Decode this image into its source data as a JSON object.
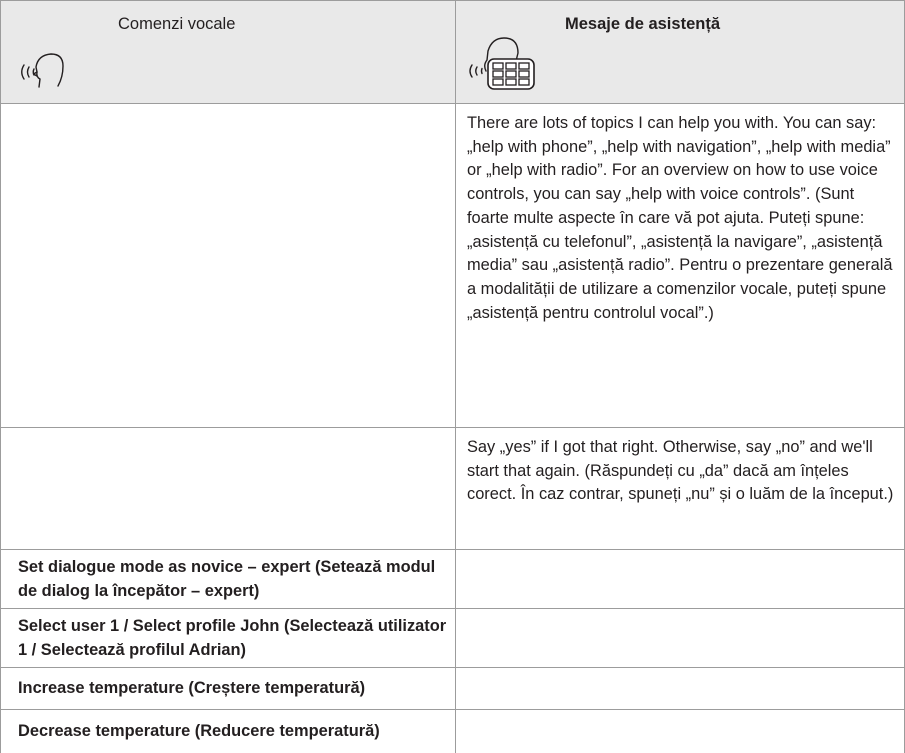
{
  "header": {
    "left_title": "Comenzi vocale",
    "right_title": "Mesaje de asistență",
    "left_icon": "voice-speaking-head-icon",
    "right_icon": "speaking-head-keypad-icon"
  },
  "rows": [
    {
      "command": "",
      "message": "There are lots of topics I can help you with. You can say: „help with phone”, „help with navigation”, „help with media” or „help with radio”. For an overview on how to use voice controls, you can say „help with voice controls”. (Sunt foarte multe aspecte în care vă pot ajuta. Puteți spune: „asistență cu telefonul”, „asistență la navigare”, „asistență media” sau „asistență radio”. Pentru o prezentare generală a modalității de utilizare a comenzilor vocale, puteți spune „asistență pentru controlul vocal”.)"
    },
    {
      "command": "",
      "message": "Say „yes” if I got that right. Otherwise, say „no” and we'll start that again. (Răspundeți cu „da” dacă am înțeles corect. În caz contrar, spuneți „nu” și o luăm de la început.)"
    },
    {
      "command": "Set dialogue mode as novice – expert (Setează modul de dialog la începător – expert)",
      "message": ""
    },
    {
      "command": "Select user 1 / Select profile John (Selectează utilizator 1 / Selectează profilul Adrian)",
      "message": ""
    },
    {
      "command": "Increase temperature (Creștere temperatură)",
      "message": ""
    },
    {
      "command": "Decrease temperature (Reducere temperatură)",
      "message": ""
    }
  ]
}
